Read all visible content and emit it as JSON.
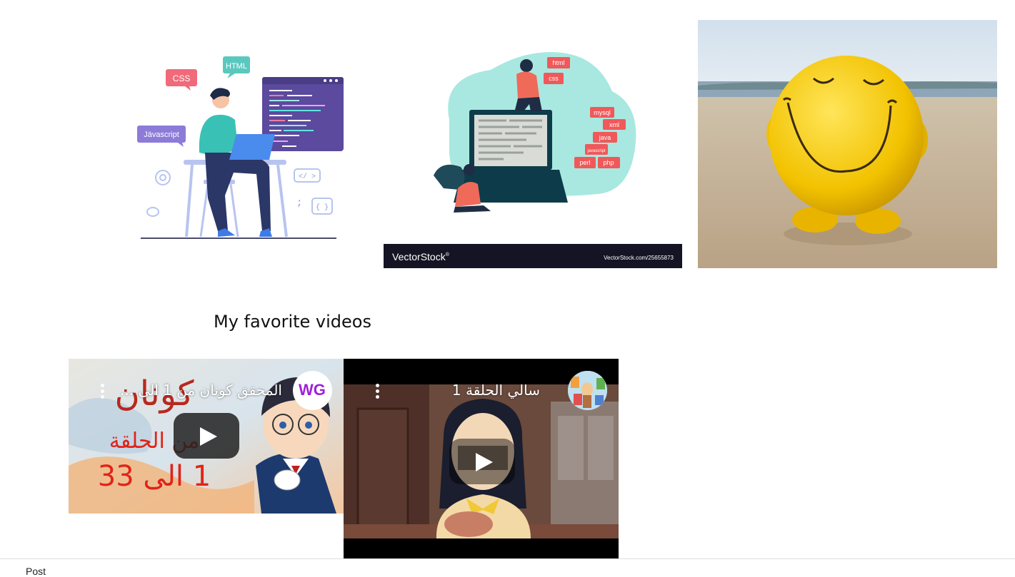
{
  "gallery": {
    "images": [
      {
        "name": "web-developer-illustration",
        "labels": {
          "css": "CSS",
          "html": "HTML",
          "javascript": "Jävascript",
          "code_tag": "</ >",
          "braces": "{ }",
          "semicolon": ";"
        }
      },
      {
        "name": "programming-languages-illustration",
        "labels": {
          "html": "html",
          "css": "css",
          "mysql": "mysql",
          "xml": "xml",
          "java": "java",
          "javascript": "javascript",
          "perl": "perl",
          "php": "php"
        },
        "brand": "VectorStock",
        "brand_mark": "®",
        "brand_url": "VectorStock.com/25655873"
      },
      {
        "name": "smiley-ball-on-beach-photo"
      }
    ]
  },
  "videos_section": {
    "title": "My favorite videos",
    "videos": [
      {
        "title": "المحقق كونان من 1 الى ...",
        "channel_avatar_text": "WG",
        "thumb_text_top": "كونان",
        "thumb_text_mid": "من الحلقة",
        "thumb_text_bottom": "1 الى 33"
      },
      {
        "title": "سالي الحلقة 1"
      }
    ]
  },
  "footer": {
    "text": "Post"
  },
  "colors": {
    "accent_red": "#f06a6a",
    "teal": "#5bc8c0",
    "purple_screen": "#5b4a9e",
    "smiley_yellow": "#f2c200",
    "youtube_play_bg": "#212121"
  }
}
